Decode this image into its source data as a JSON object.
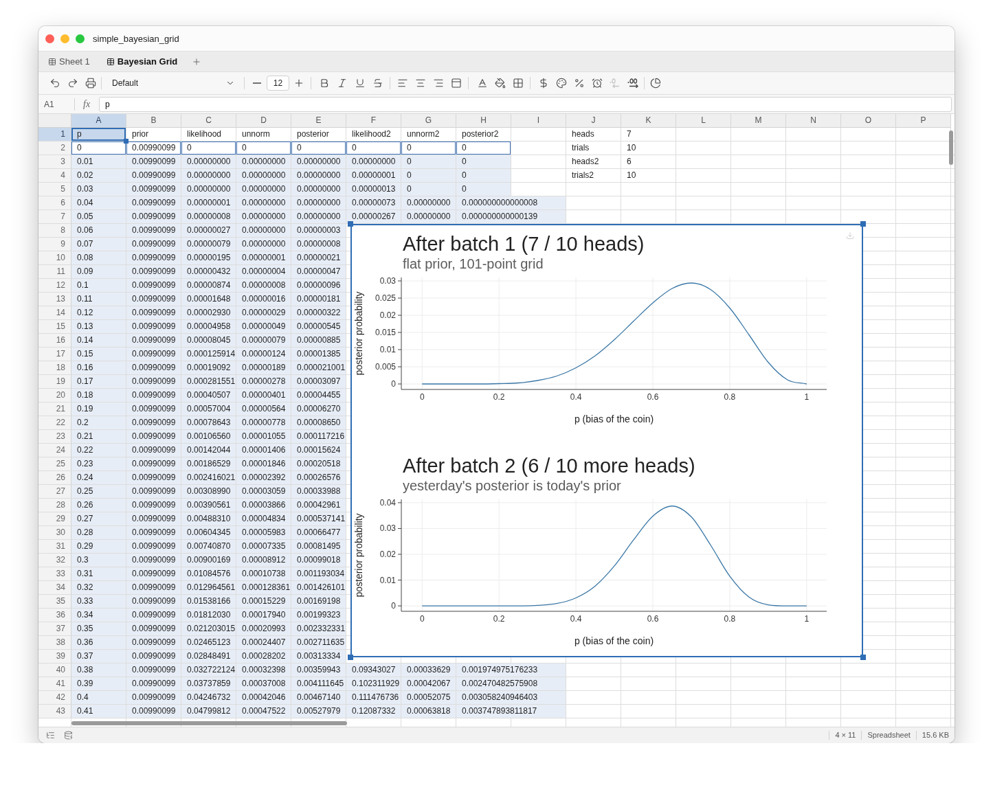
{
  "window": {
    "title": "simple_bayesian_grid"
  },
  "tabs": [
    {
      "label": "Sheet 1",
      "selected": false
    },
    {
      "label": "Bayesian Grid",
      "selected": true
    }
  ],
  "toolbar": {
    "font_family": {
      "value": "Default"
    },
    "font_size": {
      "value": "12"
    },
    "decimal_buttons": [
      {
        "disabled": true
      },
      {
        "disabled": false
      }
    ]
  },
  "formula_bar": {
    "cell_ref": "A1",
    "fx": "fx",
    "value": "p"
  },
  "grid": {
    "columns": [
      {
        "label": "A",
        "selected": true
      },
      {
        "label": "B",
        "selected": false
      },
      {
        "label": "C",
        "selected": false
      },
      {
        "label": "D",
        "selected": false
      },
      {
        "label": "E",
        "selected": false
      },
      {
        "label": "F",
        "selected": false
      },
      {
        "label": "G",
        "selected": false
      },
      {
        "label": "H",
        "selected": false
      },
      {
        "label": "I",
        "selected": false
      },
      {
        "label": "J",
        "selected": false
      },
      {
        "label": "K",
        "selected": false
      },
      {
        "label": "L",
        "selected": false
      },
      {
        "label": "M",
        "selected": false
      },
      {
        "label": "N",
        "selected": false
      },
      {
        "label": "O",
        "selected": false
      },
      {
        "label": "P",
        "selected": false
      }
    ],
    "rows": [
      {
        "number": "1",
        "selected": true,
        "tinted": false,
        "outlined": false,
        "cells": [
          "p",
          "prior",
          "likelihood",
          "unnorm",
          "posterior",
          "likelihood2",
          "unnorm2",
          "posterior2"
        ],
        "param": {
          "label": "heads",
          "value": "7"
        }
      },
      {
        "number": "2",
        "selected": false,
        "tinted": false,
        "outlined": true,
        "cells": [
          "0",
          "0.00990099",
          "0",
          "0",
          "0",
          "0",
          "0",
          "0"
        ],
        "param": {
          "label": "trials",
          "value": "10"
        }
      },
      {
        "number": "3",
        "selected": false,
        "tinted": true,
        "outlined": false,
        "cells": [
          "0.01",
          "0.00990099",
          "0.00000000",
          "0.00000000",
          "0.00000000",
          "0.00000000",
          "0",
          "0"
        ],
        "param": {
          "label": "heads2",
          "value": "6"
        }
      },
      {
        "number": "4",
        "selected": false,
        "tinted": true,
        "outlined": false,
        "cells": [
          "0.02",
          "0.00990099",
          "0.00000000",
          "0.00000000",
          "0.00000000",
          "0.00000001",
          "0",
          "0"
        ],
        "param": {
          "label": "trials2",
          "value": "10"
        }
      },
      {
        "number": "5",
        "selected": false,
        "tinted": true,
        "outlined": false,
        "cells": [
          "0.03",
          "0.00990099",
          "0.00000000",
          "0.00000000",
          "0.00000000",
          "0.00000013",
          "0",
          "0"
        ]
      },
      {
        "number": "6",
        "selected": false,
        "tinted": true,
        "outlined": false,
        "cells": [
          "0.04",
          "0.00990099",
          "0.00000001",
          "0.00000000",
          "0.00000000",
          "0.00000073",
          "0.00000000",
          "0.000000000000008"
        ]
      },
      {
        "number": "7",
        "selected": false,
        "tinted": true,
        "outlined": false,
        "cells": [
          "0.05",
          "0.00990099",
          "0.00000008",
          "0.00000000",
          "0.00000000",
          "0.00000267",
          "0.00000000",
          "0.000000000000139"
        ]
      },
      {
        "number": "8",
        "selected": false,
        "tinted": true,
        "outlined": false,
        "cells": [
          "0.06",
          "0.00990099",
          "0.00000027",
          "0.00000000",
          "0.00000003"
        ]
      },
      {
        "number": "9",
        "selected": false,
        "tinted": true,
        "outlined": false,
        "cells": [
          "0.07",
          "0.00990099",
          "0.00000079",
          "0.00000000",
          "0.00000008"
        ]
      },
      {
        "number": "10",
        "selected": false,
        "tinted": true,
        "outlined": false,
        "cells": [
          "0.08",
          "0.00990099",
          "0.00000195",
          "0.00000001",
          "0.00000021"
        ]
      },
      {
        "number": "11",
        "selected": false,
        "tinted": true,
        "outlined": false,
        "cells": [
          "0.09",
          "0.00990099",
          "0.00000432",
          "0.00000004",
          "0.00000047"
        ]
      },
      {
        "number": "12",
        "selected": false,
        "tinted": true,
        "outlined": false,
        "cells": [
          "0.1",
          "0.00990099",
          "0.00000874",
          "0.00000008",
          "0.00000096"
        ]
      },
      {
        "number": "13",
        "selected": false,
        "tinted": true,
        "outlined": false,
        "cells": [
          "0.11",
          "0.00990099",
          "0.00001648",
          "0.00000016",
          "0.00000181"
        ]
      },
      {
        "number": "14",
        "selected": false,
        "tinted": true,
        "outlined": false,
        "cells": [
          "0.12",
          "0.00990099",
          "0.00002930",
          "0.00000029",
          "0.00000322"
        ]
      },
      {
        "number": "15",
        "selected": false,
        "tinted": true,
        "outlined": false,
        "cells": [
          "0.13",
          "0.00990099",
          "0.00004958",
          "0.00000049",
          "0.00000545"
        ]
      },
      {
        "number": "16",
        "selected": false,
        "tinted": true,
        "outlined": false,
        "cells": [
          "0.14",
          "0.00990099",
          "0.00008045",
          "0.00000079",
          "0.00000885"
        ]
      },
      {
        "number": "17",
        "selected": false,
        "tinted": true,
        "outlined": false,
        "cells": [
          "0.15",
          "0.00990099",
          "0.000125914",
          "0.00000124",
          "0.00001385"
        ]
      },
      {
        "number": "18",
        "selected": false,
        "tinted": true,
        "outlined": false,
        "cells": [
          "0.16",
          "0.00990099",
          "0.00019092",
          "0.00000189",
          "0.000021001"
        ]
      },
      {
        "number": "19",
        "selected": false,
        "tinted": true,
        "outlined": false,
        "cells": [
          "0.17",
          "0.00990099",
          "0.000281551",
          "0.00000278",
          "0.00003097"
        ]
      },
      {
        "number": "20",
        "selected": false,
        "tinted": true,
        "outlined": false,
        "cells": [
          "0.18",
          "0.00990099",
          "0.00040507",
          "0.00000401",
          "0.00004455"
        ]
      },
      {
        "number": "21",
        "selected": false,
        "tinted": true,
        "outlined": false,
        "cells": [
          "0.19",
          "0.00990099",
          "0.00057004",
          "0.00000564",
          "0.00006270"
        ]
      },
      {
        "number": "22",
        "selected": false,
        "tinted": true,
        "outlined": false,
        "cells": [
          "0.2",
          "0.00990099",
          "0.00078643",
          "0.00000778",
          "0.00008650"
        ]
      },
      {
        "number": "23",
        "selected": false,
        "tinted": true,
        "outlined": false,
        "cells": [
          "0.21",
          "0.00990099",
          "0.00106560",
          "0.00001055",
          "0.000117216"
        ]
      },
      {
        "number": "24",
        "selected": false,
        "tinted": true,
        "outlined": false,
        "cells": [
          "0.22",
          "0.00990099",
          "0.00142044",
          "0.00001406",
          "0.00015624"
        ]
      },
      {
        "number": "25",
        "selected": false,
        "tinted": true,
        "outlined": false,
        "cells": [
          "0.23",
          "0.00990099",
          "0.00186529",
          "0.00001846",
          "0.00020518"
        ]
      },
      {
        "number": "26",
        "selected": false,
        "tinted": true,
        "outlined": false,
        "cells": [
          "0.24",
          "0.00990099",
          "0.002416021",
          "0.00002392",
          "0.00026576"
        ]
      },
      {
        "number": "27",
        "selected": false,
        "tinted": true,
        "outlined": false,
        "cells": [
          "0.25",
          "0.00990099",
          "0.00308990",
          "0.00003059",
          "0.00033988"
        ]
      },
      {
        "number": "28",
        "selected": false,
        "tinted": true,
        "outlined": false,
        "cells": [
          "0.26",
          "0.00990099",
          "0.00390561",
          "0.00003866",
          "0.00042961"
        ]
      },
      {
        "number": "29",
        "selected": false,
        "tinted": true,
        "outlined": false,
        "cells": [
          "0.27",
          "0.00990099",
          "0.00488310",
          "0.00004834",
          "0.000537141"
        ]
      },
      {
        "number": "30",
        "selected": false,
        "tinted": true,
        "outlined": false,
        "cells": [
          "0.28",
          "0.00990099",
          "0.00604345",
          "0.00005983",
          "0.00066477"
        ]
      },
      {
        "number": "31",
        "selected": false,
        "tinted": true,
        "outlined": false,
        "cells": [
          "0.29",
          "0.00990099",
          "0.00740870",
          "0.00007335",
          "0.00081495"
        ]
      },
      {
        "number": "32",
        "selected": false,
        "tinted": true,
        "outlined": false,
        "cells": [
          "0.3",
          "0.00990099",
          "0.00900169",
          "0.00008912",
          "0.00099018"
        ]
      },
      {
        "number": "33",
        "selected": false,
        "tinted": true,
        "outlined": false,
        "cells": [
          "0.31",
          "0.00990099",
          "0.01084576",
          "0.00010738",
          "0.001193034"
        ]
      },
      {
        "number": "34",
        "selected": false,
        "tinted": true,
        "outlined": false,
        "cells": [
          "0.32",
          "0.00990099",
          "0.012964561",
          "0.000128361",
          "0.001426101"
        ]
      },
      {
        "number": "35",
        "selected": false,
        "tinted": true,
        "outlined": false,
        "cells": [
          "0.33",
          "0.00990099",
          "0.01538166",
          "0.00015229",
          "0.00169198"
        ]
      },
      {
        "number": "36",
        "selected": false,
        "tinted": true,
        "outlined": false,
        "cells": [
          "0.34",
          "0.00990099",
          "0.01812030",
          "0.00017940",
          "0.00199323"
        ]
      },
      {
        "number": "37",
        "selected": false,
        "tinted": true,
        "outlined": false,
        "cells": [
          "0.35",
          "0.00990099",
          "0.021203015",
          "0.00020993",
          "0.002332331"
        ]
      },
      {
        "number": "38",
        "selected": false,
        "tinted": true,
        "outlined": false,
        "cells": [
          "0.36",
          "0.00990099",
          "0.02465123",
          "0.00024407",
          "0.002711635"
        ]
      },
      {
        "number": "39",
        "selected": false,
        "tinted": true,
        "outlined": false,
        "cells": [
          "0.37",
          "0.00990099",
          "0.02848491",
          "0.00028202",
          "0.00313334"
        ]
      },
      {
        "number": "40",
        "selected": false,
        "tinted": true,
        "outlined": false,
        "cells": [
          "0.38",
          "0.00990099",
          "0.032722124",
          "0.00032398",
          "0.00359943",
          "0.09343027",
          "0.00033629",
          "0.001974975176233"
        ]
      },
      {
        "number": "41",
        "selected": false,
        "tinted": true,
        "outlined": false,
        "cells": [
          "0.39",
          "0.00990099",
          "0.03737859",
          "0.00037008",
          "0.004111645",
          "0.102311929",
          "0.00042067",
          "0.002470482575908"
        ]
      },
      {
        "number": "42",
        "selected": false,
        "tinted": true,
        "outlined": false,
        "cells": [
          "0.4",
          "0.00990099",
          "0.04246732",
          "0.00042046",
          "0.00467140",
          "0.111476736",
          "0.00052075",
          "0.003058240946403"
        ]
      },
      {
        "number": "43",
        "selected": false,
        "tinted": true,
        "outlined": false,
        "cells": [
          "0.41",
          "0.00990099",
          "0.04799812",
          "0.00047522",
          "0.00527979",
          "0.12087332",
          "0.00063818",
          "0.003747893811817"
        ]
      }
    ]
  },
  "chart_object": {
    "selected": true,
    "panels": [
      {
        "subtitle": "flat prior, 101-point grid",
        "chart_data": {
          "type": "line",
          "title": "After batch 1 (7 / 10 heads)",
          "xlabel": "p (bias of the coin)",
          "ylabel": "posterior probability",
          "grid": true,
          "x": [
            0,
            0.05,
            0.1,
            0.15,
            0.2,
            0.25,
            0.3,
            0.35,
            0.4,
            0.45,
            0.5,
            0.55,
            0.6,
            0.65,
            0.7,
            0.75,
            0.8,
            0.85,
            0.9,
            0.95,
            1
          ],
          "series": [
            {
              "color": "#3a77a6",
              "values": [
                0,
                0,
                0,
                0,
                0.0001,
                0.0003,
                0.001,
                0.0023,
                0.0047,
                0.0082,
                0.0129,
                0.0183,
                0.0236,
                0.0278,
                0.0294,
                0.0275,
                0.0221,
                0.0143,
                0.0063,
                0.0012,
                0
              ]
            }
          ],
          "xlim": [
            -0.054,
            1.052
          ],
          "ylim": [
            -0.0016,
            0.031
          ],
          "xticks": [
            0,
            0.2,
            0.4,
            0.6,
            0.8,
            1
          ],
          "yticks": [
            0,
            0.005,
            0.01,
            0.015,
            0.02,
            0.025,
            0.03
          ]
        }
      },
      {
        "subtitle": "yesterday's posterior is today's prior",
        "chart_data": {
          "type": "line",
          "title": "After batch 2 (6 / 10 more heads)",
          "xlabel": "p (bias of the coin)",
          "ylabel": "posterior probability",
          "grid": true,
          "x": [
            0,
            0.05,
            0.1,
            0.15,
            0.2,
            0.25,
            0.3,
            0.35,
            0.4,
            0.45,
            0.5,
            0.55,
            0.6,
            0.65,
            0.7,
            0.75,
            0.8,
            0.85,
            0.9,
            0.95,
            1
          ],
          "series": [
            {
              "color": "#3a77a6",
              "values": [
                0,
                0,
                0,
                0,
                0,
                0,
                0.0002,
                0.0009,
                0.0031,
                0.0077,
                0.0155,
                0.0256,
                0.0348,
                0.0387,
                0.0345,
                0.0236,
                0.0115,
                0.0034,
                0.0004,
                0,
                0
              ]
            }
          ],
          "xlim": [
            -0.054,
            1.052
          ],
          "ylim": [
            -0.0021,
            0.0413
          ],
          "xticks": [
            0,
            0.2,
            0.4,
            0.6,
            0.8,
            1
          ],
          "yticks": [
            0,
            0.01,
            0.02,
            0.03,
            0.04
          ]
        }
      }
    ]
  },
  "status_bar": {
    "dimensions": "4 × 11",
    "file_type": "Spreadsheet",
    "file_size": "15.6 KB"
  }
}
